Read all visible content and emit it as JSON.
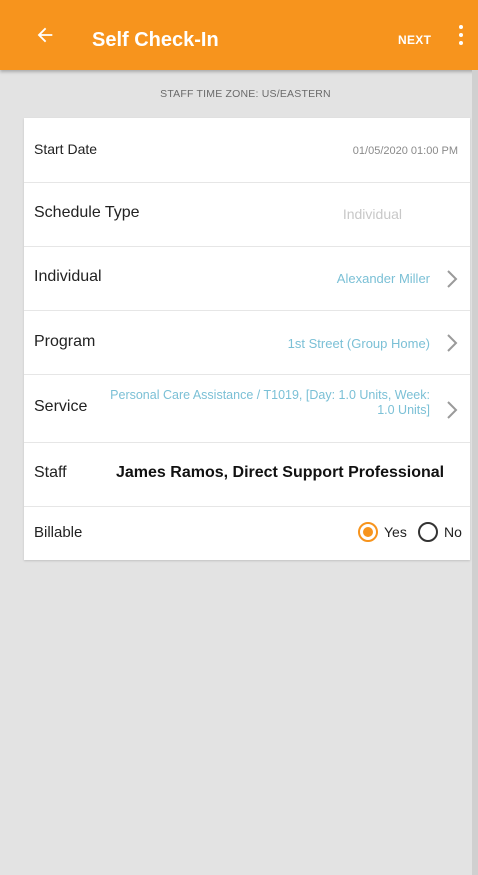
{
  "appbar": {
    "title": "Self Check-In",
    "next_label": "NEXT",
    "back_icon": "arrow-left-icon",
    "more_icon": "more-vert-icon",
    "color": "#f7941d"
  },
  "timezone_text": "STAFF TIME ZONE: US/EASTERN",
  "fields": {
    "start_date": {
      "label": "Start Date",
      "value": "01/05/2020 01:00 PM"
    },
    "schedule_type": {
      "label": "Schedule Type",
      "value": "Individual"
    },
    "individual": {
      "label": "Individual",
      "value": "Alexander Miller"
    },
    "program": {
      "label": "Program",
      "value": "1st Street (Group Home)"
    },
    "service": {
      "label": "Service",
      "value": "Personal Care Assistance / T1019,  [Day: 1.0 Units, Week:  1.0 Units]"
    },
    "staff": {
      "label": "Staff",
      "value": "James Ramos, Direct Support Professional"
    },
    "billable": {
      "label": "Billable",
      "yes_label": "Yes",
      "no_label": "No",
      "selected": "Yes"
    }
  },
  "colors": {
    "accent": "#f7941d",
    "link_value": "#7bc0d6"
  }
}
